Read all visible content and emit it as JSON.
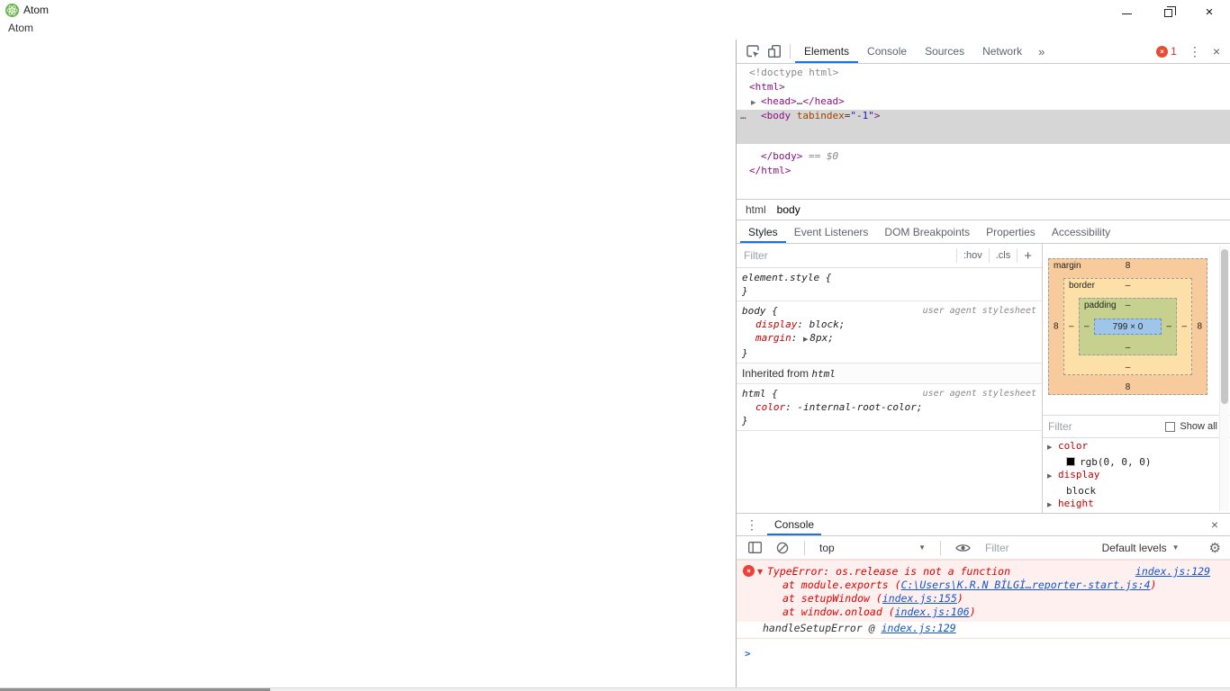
{
  "icons": {
    "close": "×",
    "kebab": "⋮",
    "more_tabs": "»",
    "dropdown": "▼",
    "tree_arrow_collapsed": "▶",
    "inline_arrow": "▶",
    "gear": "⚙",
    "prompt": ">",
    "error_x": "×"
  },
  "window": {
    "title": "Atom",
    "menu": "Atom"
  },
  "devtools": {
    "main_tabs": [
      {
        "label": "Elements",
        "selected": true
      },
      {
        "label": "Console",
        "selected": false
      },
      {
        "label": "Sources",
        "selected": false
      },
      {
        "label": "Network",
        "selected": false
      }
    ],
    "error_badge_count": "1",
    "elements_tree": {
      "lines": [
        {
          "indent": 0,
          "tokens": [
            {
              "t": "<!doctype html>",
              "c": "doctype"
            }
          ]
        },
        {
          "indent": 0,
          "tokens": [
            {
              "t": "<html>",
              "c": "tag"
            }
          ]
        },
        {
          "indent": 1,
          "arrow": true,
          "tokens": [
            {
              "t": "<head>",
              "c": "tag"
            },
            {
              "t": "…",
              "c": "plain"
            },
            {
              "t": "</head>",
              "c": "tag"
            }
          ]
        },
        {
          "indent": 1,
          "selected": true,
          "guide": "…",
          "tokens": [
            {
              "t": "<body",
              "c": "tag"
            },
            {
              "t": " tabindex",
              "c": "attr"
            },
            {
              "t": "=",
              "c": "plain"
            },
            {
              "t": "\"-1\"",
              "c": "value"
            },
            {
              "t": ">",
              "c": "tag"
            }
          ]
        },
        {
          "indent": 1,
          "tokens": [
            {
              "t": "</body>",
              "c": "tag"
            },
            {
              "t": " == $0",
              "c": "annotation"
            }
          ]
        },
        {
          "indent": 0,
          "tokens": [
            {
              "t": "</html>",
              "c": "tag"
            }
          ]
        }
      ],
      "breadcrumbs": [
        {
          "label": "html",
          "selected": false
        },
        {
          "label": "body",
          "selected": true
        }
      ]
    },
    "panel_tabs": [
      {
        "label": "Styles",
        "selected": true
      },
      {
        "label": "Event Listeners",
        "selected": false
      },
      {
        "label": "DOM Breakpoints",
        "selected": false
      },
      {
        "label": "Properties",
        "selected": false
      },
      {
        "label": "Accessibility",
        "selected": false
      }
    ],
    "styles_pane": {
      "filter_placeholder": "Filter",
      "pseudo_label": ":hov",
      "class_label": ".cls",
      "new_rule_label": "+",
      "open_brace": "{",
      "close_brace": "}",
      "separator": ": ",
      "sections": [
        {
          "type": "rule",
          "selector": "element.style",
          "origin": "",
          "props": []
        },
        {
          "type": "rule",
          "selector": "body",
          "origin": "user agent stylesheet",
          "props": [
            {
              "name": "display",
              "value": "block;"
            },
            {
              "name": "margin",
              "value": "8px;",
              "arrow": true
            }
          ]
        },
        {
          "type": "inherited",
          "label": "Inherited from",
          "link": "html"
        },
        {
          "type": "rule",
          "selector": "html",
          "origin": "user agent stylesheet",
          "props": [
            {
              "name": "color",
              "value": "-internal-root-color;"
            }
          ]
        }
      ]
    },
    "box_model": {
      "margin": {
        "label": "margin",
        "top": "8",
        "right": "8",
        "bottom": "8",
        "left": "8"
      },
      "border": {
        "label": "border",
        "top": "–",
        "right": "–",
        "bottom": "–",
        "left": "–"
      },
      "padding": {
        "label": "padding",
        "top": "–",
        "right": "–",
        "bottom": "–",
        "left": "–"
      },
      "content": "799 × 0"
    },
    "computed": {
      "filter_placeholder": "Filter",
      "show_all_label": "Show all",
      "properties": [
        {
          "name": "color",
          "value": "rgb(0, 0, 0)",
          "swatch": "#000000"
        },
        {
          "name": "display",
          "value": "block"
        },
        {
          "name": "height",
          "value": ""
        }
      ]
    },
    "console": {
      "tab_label": "Console",
      "context_label": "top",
      "filter_placeholder": "Filter",
      "levels_label": "Default levels",
      "error": {
        "message": "TypeError: os.release is not a function",
        "source_link": "index.js:129",
        "frames": [
          {
            "pre": "at module.exports (",
            "link": "C:\\Users\\K.R.N BİLGİ…reporter-start.js:4",
            "post": ")"
          },
          {
            "pre": "at setupWindow (",
            "link": "index.js:155",
            "post": ")"
          },
          {
            "pre": "at window.onload (",
            "link": "index.js:106",
            "post": ")"
          }
        ],
        "handler_prefix": "handleSetupError @ ",
        "handler_link": "index.js:129"
      }
    }
  }
}
